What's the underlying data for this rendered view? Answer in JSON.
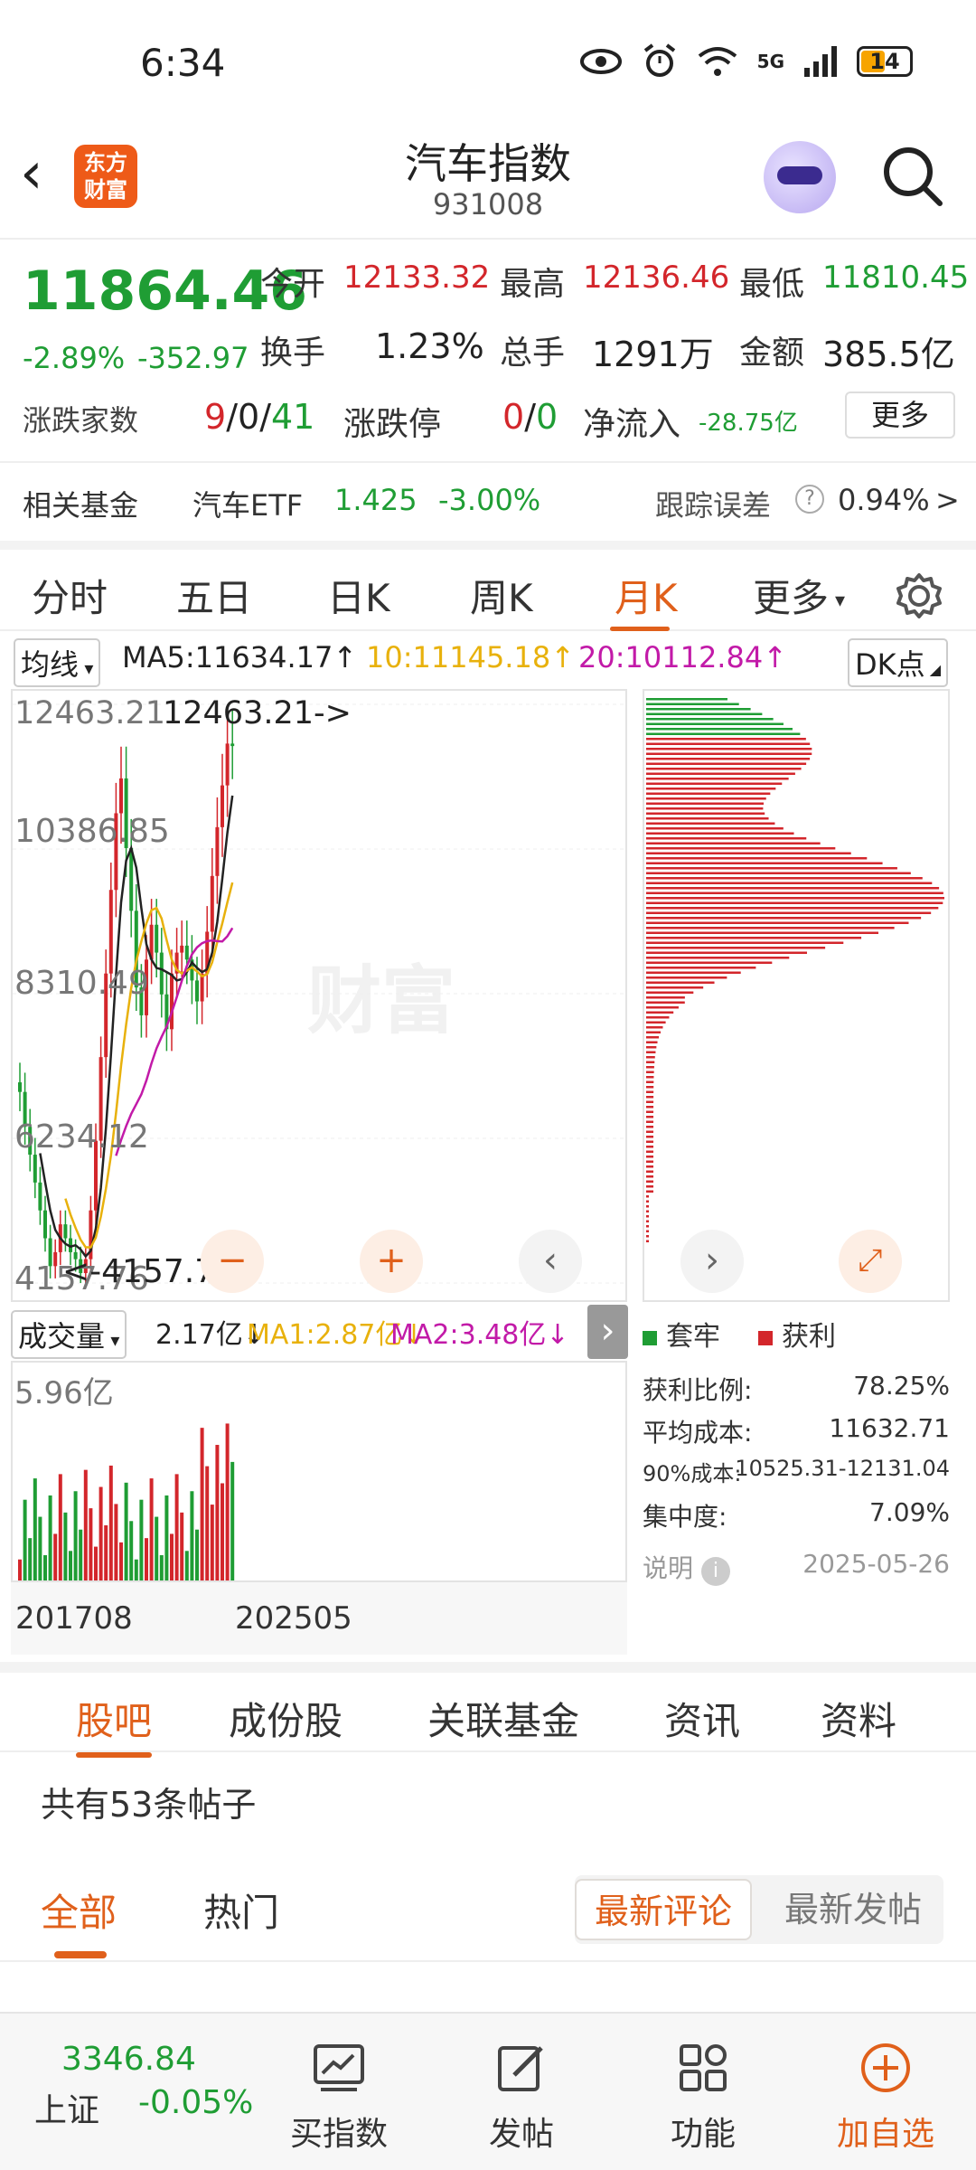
{
  "status_bar": {
    "time": "6:34",
    "network": "5G",
    "battery": "14"
  },
  "header": {
    "title": "汽车指数",
    "code": "931008",
    "logo_text": "东方财富"
  },
  "quote": {
    "price": "11864.46",
    "change_pct": "-2.89%",
    "change": "-352.97",
    "open_label": "今开",
    "open": "12133.32",
    "high_label": "最高",
    "high": "12136.46",
    "low_label": "最低",
    "low": "11810.45",
    "turnover_label": "换手",
    "turnover": "1.23%",
    "volume_label": "总手",
    "volume": "1291万",
    "amount_label": "金额",
    "amount": "385.5亿",
    "updown_label": "涨跌家数",
    "up": "9",
    "flat": "0",
    "down": "41",
    "limit_label": "涨跌停",
    "limit_up": "0",
    "limit_down": "0",
    "netflow_label": "净流入",
    "netflow": "-28.75亿",
    "more": "更多"
  },
  "fund_row": {
    "label": "相关基金",
    "fund_name": "汽车ETF",
    "fund_price": "1.425",
    "fund_change": "-3.00%",
    "tracking_label": "跟踪误差",
    "tracking_value": "0.94%"
  },
  "period_tabs": [
    "分时",
    "五日",
    "日K",
    "周K",
    "月K",
    "更多"
  ],
  "active_period": "月K",
  "ma_row": {
    "indicator": "均线",
    "ma5": "MA5:11634.17",
    "ma10": "10:11145.18",
    "ma20": "20:10112.84",
    "dk": "DK点"
  },
  "main_chart": {
    "y_labels": [
      "12463.21",
      "10386.85",
      "8310.49",
      "6234.12",
      "4157.76"
    ],
    "max_marker": "12463.21->",
    "min_marker": "<-4157.76",
    "watermark": "财富"
  },
  "volume": {
    "indicator": "成交量",
    "vol": "2.17亿",
    "ma1": "MA1:2.87亿",
    "ma2": "MA2:3.48亿",
    "y_max": "5.96亿",
    "x_start": "201708",
    "x_end": "202505"
  },
  "distribution": {
    "legend_trapped": "套牢",
    "legend_profit": "获利",
    "profit_ratio_label": "获利比例:",
    "profit_ratio": "78.25%",
    "avg_cost_label": "平均成本:",
    "avg_cost": "11632.71",
    "cost90_label": "90%成本:",
    "cost90": "10525.31-12131.04",
    "concentration_label": "集中度:",
    "concentration": "7.09%",
    "note_label": "说明",
    "date": "2025-05-26"
  },
  "content_tabs": [
    "股吧",
    "成份股",
    "关联基金",
    "资讯",
    "资料"
  ],
  "posts_count": "共有53条帖子",
  "sub_tabs": [
    "全部",
    "热门"
  ],
  "sort_options": [
    "最新评论",
    "最新发帖"
  ],
  "bottom_nav": {
    "sh_price": "3346.84",
    "sh_label": "上证",
    "sh_change": "-0.05%",
    "items": [
      "买指数",
      "发帖",
      "功能",
      "加自选"
    ]
  },
  "colors": {
    "up": "#d3262b",
    "down": "#1f9d34",
    "accent": "#e0601b",
    "ma5": "#222222",
    "ma10": "#e8b10c",
    "ma20": "#c21aa8"
  },
  "chart_data": {
    "type": "candlestick",
    "period": "monthly",
    "ylim": [
      4157.76,
      12463.21
    ],
    "y_ticks": [
      12463.21,
      10386.85,
      8310.49,
      6234.12,
      4157.76
    ],
    "x_range": [
      "201708",
      "202505"
    ],
    "close_series_approx": [
      6900,
      6400,
      6000,
      5600,
      5200,
      4800,
      4400,
      4600,
      5000,
      4800,
      4600,
      4500,
      4300,
      4500,
      5200,
      6200,
      7400,
      8600,
      9800,
      10900,
      11400,
      10400,
      9500,
      8400,
      8000,
      8800,
      9300,
      8900,
      8300,
      7800,
      8600,
      8900,
      9000,
      8800,
      8500,
      8200,
      8600,
      9200,
      10000,
      10700,
      11300,
      11900,
      11864.46
    ],
    "volume_ylim": [
      0,
      5.96
    ],
    "volume_unit": "亿"
  }
}
